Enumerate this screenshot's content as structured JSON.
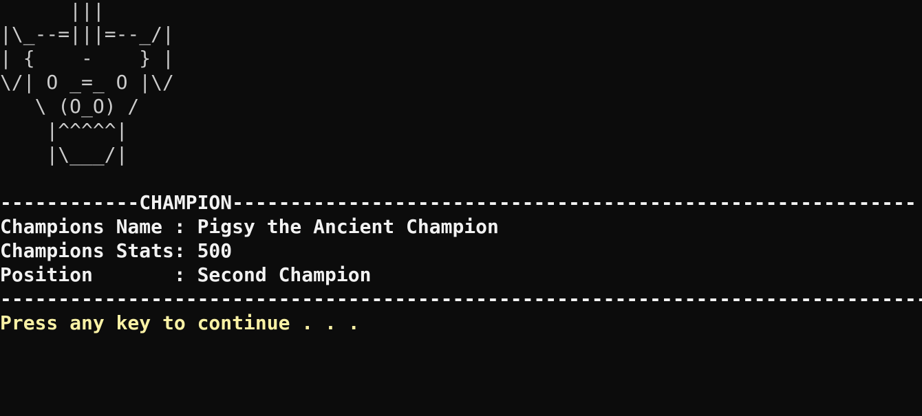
{
  "terminal": {
    "art_lines": [
      "      |||",
      "|\\_--=|||=--_/|",
      "| {    -    } |",
      "\\/| O _=_ O |\\/",
      "   \\ (O_O) /",
      "    |^^^^^|",
      "    |\\___/|"
    ],
    "header_rule": "------------CHAMPION-----------------------------------------------------------",
    "name_line": "Champions Name : Pigsy the Ancient Champion",
    "stats_line": "Champions Stats: 500",
    "position_line": "Position       : Second Champion",
    "footer_rule": "--------------------------------------------------------------------------------",
    "prompt": "Press any key to continue . . ."
  },
  "colors": {
    "background": "#0c0c0c",
    "text": "#cccccc",
    "bold_text": "#f2f2f2",
    "prompt": "#f9f1a5"
  }
}
